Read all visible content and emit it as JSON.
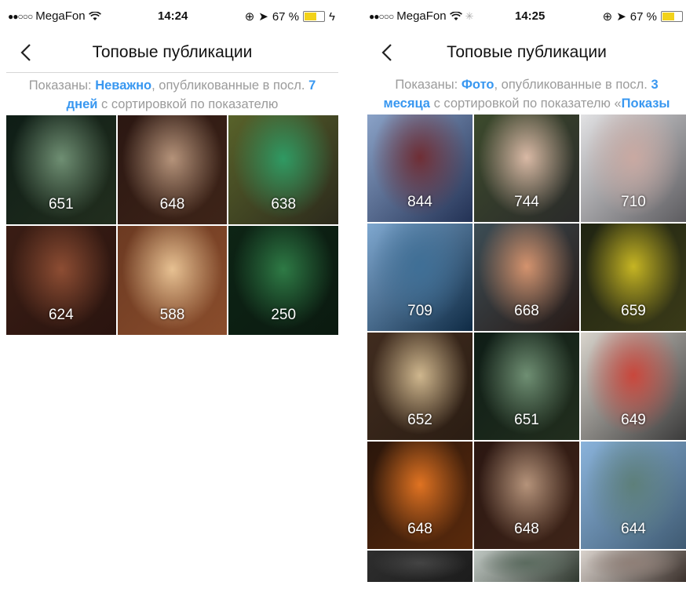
{
  "left": {
    "status": {
      "carrier": "MegaFon",
      "time": "14:24",
      "battery": "67 %"
    },
    "nav": {
      "title": "Топовые публикации"
    },
    "filter": {
      "prefix": "Показаны: ",
      "type": "Неважно",
      "middle": ", опубликованные в посл. ",
      "period": "7 дней",
      "suffix": " с сортировкой по показателю"
    },
    "tiles": [
      {
        "count": "651",
        "colors": [
          "#0e1d16",
          "#6f8f73",
          "#222e1e"
        ]
      },
      {
        "count": "648",
        "colors": [
          "#2b1712",
          "#b5937a",
          "#3e2418"
        ]
      },
      {
        "count": "638",
        "colors": [
          "#58622a",
          "#2f9a63",
          "#2c2a1c"
        ]
      },
      {
        "count": "624",
        "colors": [
          "#3a1d14",
          "#8d4d33",
          "#2a140f"
        ]
      },
      {
        "count": "588",
        "colors": [
          "#6c3a22",
          "#e7c192",
          "#8a4d2c"
        ]
      },
      {
        "count": "250",
        "colors": [
          "#0d2415",
          "#2e7a45",
          "#0b1a10"
        ]
      }
    ]
  },
  "right": {
    "status": {
      "carrier": "MegaFon",
      "time": "14:25",
      "battery": "67 %"
    },
    "nav": {
      "title": "Топовые публикации"
    },
    "filter": {
      "prefix": "Показаны: ",
      "type": "Фото",
      "middle": ", опубликованные в посл. ",
      "period": "3 месяца",
      "suffix": " с сортировкой по показателю «",
      "sort": "Показы"
    },
    "tiles": [
      {
        "count": "844",
        "colors": [
          "#8aa2c7",
          "#6f2e35",
          "#233255"
        ]
      },
      {
        "count": "744",
        "colors": [
          "#3c4a2c",
          "#d9b9a5",
          "#2a2a2a"
        ]
      },
      {
        "count": "710",
        "colors": [
          "#e2e2e4",
          "#c9a9a2",
          "#5d5c60"
        ]
      },
      {
        "count": "709",
        "colors": [
          "#7fa8d0",
          "#3f6f96",
          "#0f2b45"
        ]
      },
      {
        "count": "668",
        "colors": [
          "#3c4d55",
          "#d4936e",
          "#281a16"
        ]
      },
      {
        "count": "659",
        "colors": [
          "#1f2412",
          "#c6b523",
          "#3a3a18"
        ]
      },
      {
        "count": "652",
        "colors": [
          "#402c1f",
          "#cfb78e",
          "#2b1d13"
        ]
      },
      {
        "count": "651",
        "colors": [
          "#0e1d16",
          "#6f8f73",
          "#222e1e"
        ]
      },
      {
        "count": "649",
        "colors": [
          "#d8d4cc",
          "#c9473c",
          "#3b3b3b"
        ]
      },
      {
        "count": "648",
        "colors": [
          "#2a160b",
          "#e07322",
          "#5a2a0c"
        ]
      },
      {
        "count": "648",
        "colors": [
          "#2b1712",
          "#b5937a",
          "#3e2418"
        ]
      },
      {
        "count": "644",
        "colors": [
          "#8ab3db",
          "#5d7f7a",
          "#3f5a72"
        ]
      },
      {
        "count": "",
        "colors": [
          "#2e2e2e",
          "#444444",
          "#1c1c1c"
        ]
      },
      {
        "count": "",
        "colors": [
          "#bfc7c2",
          "#5b6b5f",
          "#30382f"
        ]
      },
      {
        "count": "",
        "colors": [
          "#d9d2cc",
          "#8f7f77",
          "#3a302b"
        ]
      }
    ]
  }
}
